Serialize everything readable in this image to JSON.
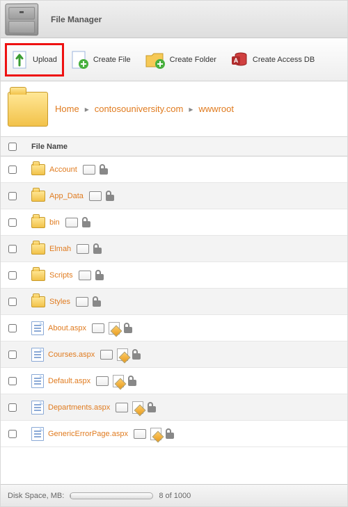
{
  "header": {
    "title": "File Manager"
  },
  "toolbar": {
    "upload": "Upload",
    "create_file": "Create File",
    "create_folder": "Create Folder",
    "create_access_db": "Create Access DB"
  },
  "breadcrumb": {
    "items": [
      "Home",
      "contosouniversity.com",
      "wwwroot"
    ]
  },
  "table": {
    "header": "File Name",
    "rows": [
      {
        "name": "Account",
        "type": "folder"
      },
      {
        "name": "App_Data",
        "type": "folder"
      },
      {
        "name": "bin",
        "type": "folder"
      },
      {
        "name": "Elmah",
        "type": "folder"
      },
      {
        "name": "Scripts",
        "type": "folder"
      },
      {
        "name": "Styles",
        "type": "folder"
      },
      {
        "name": "About.aspx",
        "type": "file"
      },
      {
        "name": "Courses.aspx",
        "type": "file"
      },
      {
        "name": "Default.aspx",
        "type": "file"
      },
      {
        "name": "Departments.aspx",
        "type": "file"
      },
      {
        "name": "GenericErrorPage.aspx",
        "type": "file"
      }
    ]
  },
  "footer": {
    "label": "Disk Space, MB:",
    "text": "8 of 1000",
    "used": 8,
    "total": 1000
  }
}
